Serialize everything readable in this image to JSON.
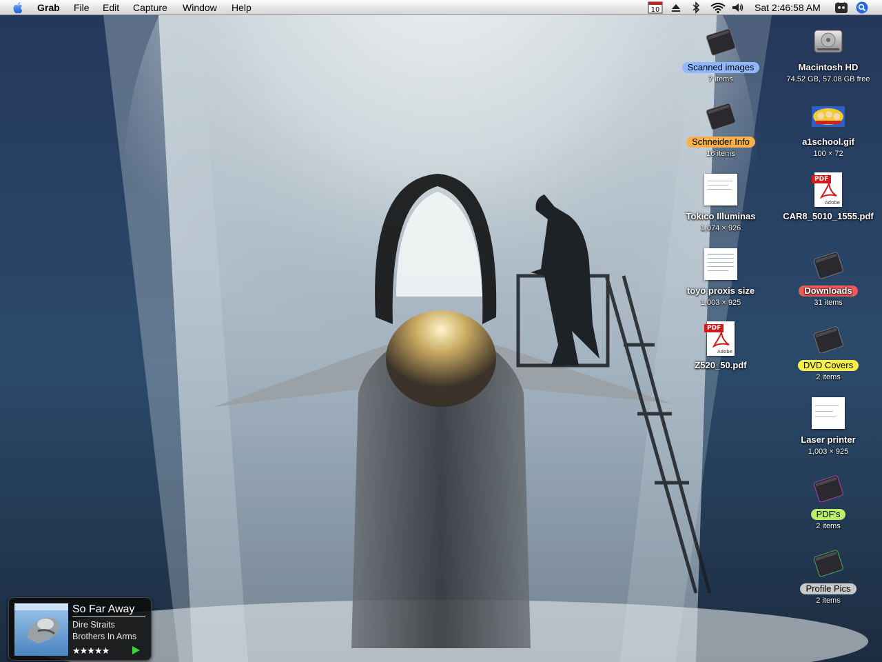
{
  "menubar": {
    "app_name": "Grab",
    "menus": [
      "File",
      "Edit",
      "Capture",
      "Window",
      "Help"
    ],
    "status_icons": [
      "calendar-icon",
      "eject-icon",
      "bluetooth-icon",
      "wifi-icon",
      "volume-icon"
    ],
    "calendar_day": "10",
    "clock": "Sat 2:46:58 AM",
    "extra_icons": [
      "menu-extra-icon",
      "spotlight-icon"
    ]
  },
  "desktop_icons": [
    {
      "name": "Scanned images",
      "info": "7 items",
      "type": "folder",
      "label_color": "#8fb8ff",
      "icon": "folder-icon"
    },
    {
      "name": "Macintosh HD",
      "info": "74.52 GB, 57.08 GB free",
      "type": "drive",
      "label_color": "",
      "icon": "hard-drive-icon"
    },
    {
      "name": "Schneider Info",
      "info": "16 items",
      "type": "folder",
      "label_color": "#f7b04b",
      "icon": "folder-icon"
    },
    {
      "name": "a1school.gif",
      "info": "100 × 72",
      "type": "image",
      "label_color": "",
      "icon": "gif-image-icon"
    },
    {
      "name": "Tokico Illuminas",
      "info": "1,074 × 926",
      "type": "image",
      "label_color": "",
      "icon": "image-file-icon"
    },
    {
      "name": "CAR8_5010_1555.pdf",
      "info": "",
      "type": "pdf",
      "label_color": "",
      "icon": "pdf-file-icon"
    },
    {
      "name": "toyo proxis size",
      "info": "1,003 × 925",
      "type": "image",
      "label_color": "",
      "icon": "image-file-icon"
    },
    {
      "name": "Downloads",
      "info": "31 items",
      "type": "folder",
      "label_color": "#ee5a5a",
      "icon": "folder-icon"
    },
    {
      "name": "Z520_50.pdf",
      "info": "",
      "type": "pdf",
      "label_color": "",
      "icon": "pdf-file-icon"
    },
    {
      "name": "DVD Covers",
      "info": "2 items",
      "type": "folder",
      "label_color": "#f4ee4a",
      "icon": "folder-icon"
    },
    {
      "name": "Laser printer",
      "info": "1,003 × 925",
      "type": "image",
      "label_color": "",
      "icon": "image-file-icon"
    },
    {
      "name": "PDF's",
      "info": "2 items",
      "type": "folder",
      "label_color": "#b9ee6a",
      "icon": "folder-icon"
    },
    {
      "name": "Profile Pics",
      "info": "2 items",
      "type": "folder",
      "label_color": "#c8c8c8",
      "icon": "folder-icon"
    }
  ],
  "now_playing": {
    "title": "So Far Away",
    "artist": "Dire Straits",
    "album": "Brothers In Arms",
    "rating": "★★★★★",
    "rating_value": 5
  }
}
